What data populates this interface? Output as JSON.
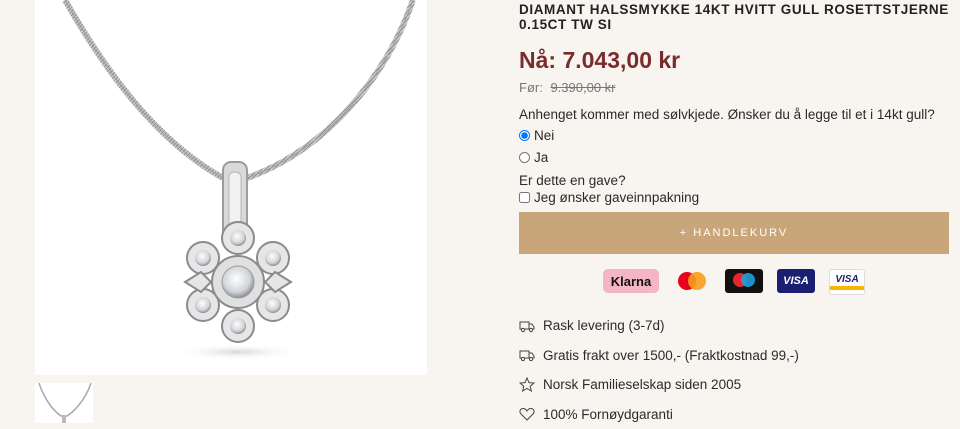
{
  "product": {
    "title": "DIAMANT HALSSMYKKE 14KT HVITT GULL ROSETTSTJERNE 0.15CT TW SI",
    "price_now": "Nå: 7.043,00 kr",
    "price_before_label": "Før:",
    "price_before_amount": "9.390,00 kr"
  },
  "chain_option": {
    "question": "Anhenget kommer med sølvkjede. Ønsker du å legge til et i 14kt gull?",
    "options": [
      {
        "label": "Nei",
        "checked": true
      },
      {
        "label": "Ja",
        "checked": false
      }
    ]
  },
  "gift": {
    "question": "Er dette en gave?",
    "checkbox_label": "Jeg ønsker gaveinnpakning"
  },
  "cart_button": "+ HANDLEKURV",
  "payments": {
    "klarna": "Klarna",
    "visa": "VISA",
    "visa_electron": "VISA"
  },
  "usps": [
    {
      "icon": "truck-icon",
      "text": "Rask levering (3-7d)"
    },
    {
      "icon": "truck-icon",
      "text": "Gratis frakt over 1500,- (Fraktkostnad 99,-)"
    },
    {
      "icon": "star-icon",
      "text": "Norsk Familieselskap siden 2005"
    },
    {
      "icon": "heart-icon",
      "text": "100% Fornøydgaranti"
    }
  ],
  "colors": {
    "background": "#f8f5f0",
    "price": "#7a2b2b",
    "button": "#c9a67a",
    "klarna": "#f4b6c7"
  }
}
